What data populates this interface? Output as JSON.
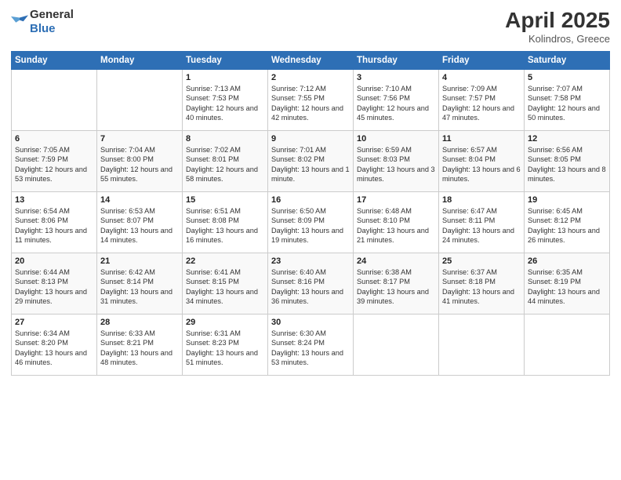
{
  "logo": {
    "general": "General",
    "blue": "Blue"
  },
  "title": {
    "month": "April 2025",
    "location": "Kolindros, Greece"
  },
  "weekdays": [
    "Sunday",
    "Monday",
    "Tuesday",
    "Wednesday",
    "Thursday",
    "Friday",
    "Saturday"
  ],
  "weeks": [
    [
      {
        "day": "",
        "info": ""
      },
      {
        "day": "",
        "info": ""
      },
      {
        "day": "1",
        "info": "Sunrise: 7:13 AM\nSunset: 7:53 PM\nDaylight: 12 hours and 40 minutes."
      },
      {
        "day": "2",
        "info": "Sunrise: 7:12 AM\nSunset: 7:55 PM\nDaylight: 12 hours and 42 minutes."
      },
      {
        "day": "3",
        "info": "Sunrise: 7:10 AM\nSunset: 7:56 PM\nDaylight: 12 hours and 45 minutes."
      },
      {
        "day": "4",
        "info": "Sunrise: 7:09 AM\nSunset: 7:57 PM\nDaylight: 12 hours and 47 minutes."
      },
      {
        "day": "5",
        "info": "Sunrise: 7:07 AM\nSunset: 7:58 PM\nDaylight: 12 hours and 50 minutes."
      }
    ],
    [
      {
        "day": "6",
        "info": "Sunrise: 7:05 AM\nSunset: 7:59 PM\nDaylight: 12 hours and 53 minutes."
      },
      {
        "day": "7",
        "info": "Sunrise: 7:04 AM\nSunset: 8:00 PM\nDaylight: 12 hours and 55 minutes."
      },
      {
        "day": "8",
        "info": "Sunrise: 7:02 AM\nSunset: 8:01 PM\nDaylight: 12 hours and 58 minutes."
      },
      {
        "day": "9",
        "info": "Sunrise: 7:01 AM\nSunset: 8:02 PM\nDaylight: 13 hours and 1 minute."
      },
      {
        "day": "10",
        "info": "Sunrise: 6:59 AM\nSunset: 8:03 PM\nDaylight: 13 hours and 3 minutes."
      },
      {
        "day": "11",
        "info": "Sunrise: 6:57 AM\nSunset: 8:04 PM\nDaylight: 13 hours and 6 minutes."
      },
      {
        "day": "12",
        "info": "Sunrise: 6:56 AM\nSunset: 8:05 PM\nDaylight: 13 hours and 8 minutes."
      }
    ],
    [
      {
        "day": "13",
        "info": "Sunrise: 6:54 AM\nSunset: 8:06 PM\nDaylight: 13 hours and 11 minutes."
      },
      {
        "day": "14",
        "info": "Sunrise: 6:53 AM\nSunset: 8:07 PM\nDaylight: 13 hours and 14 minutes."
      },
      {
        "day": "15",
        "info": "Sunrise: 6:51 AM\nSunset: 8:08 PM\nDaylight: 13 hours and 16 minutes."
      },
      {
        "day": "16",
        "info": "Sunrise: 6:50 AM\nSunset: 8:09 PM\nDaylight: 13 hours and 19 minutes."
      },
      {
        "day": "17",
        "info": "Sunrise: 6:48 AM\nSunset: 8:10 PM\nDaylight: 13 hours and 21 minutes."
      },
      {
        "day": "18",
        "info": "Sunrise: 6:47 AM\nSunset: 8:11 PM\nDaylight: 13 hours and 24 minutes."
      },
      {
        "day": "19",
        "info": "Sunrise: 6:45 AM\nSunset: 8:12 PM\nDaylight: 13 hours and 26 minutes."
      }
    ],
    [
      {
        "day": "20",
        "info": "Sunrise: 6:44 AM\nSunset: 8:13 PM\nDaylight: 13 hours and 29 minutes."
      },
      {
        "day": "21",
        "info": "Sunrise: 6:42 AM\nSunset: 8:14 PM\nDaylight: 13 hours and 31 minutes."
      },
      {
        "day": "22",
        "info": "Sunrise: 6:41 AM\nSunset: 8:15 PM\nDaylight: 13 hours and 34 minutes."
      },
      {
        "day": "23",
        "info": "Sunrise: 6:40 AM\nSunset: 8:16 PM\nDaylight: 13 hours and 36 minutes."
      },
      {
        "day": "24",
        "info": "Sunrise: 6:38 AM\nSunset: 8:17 PM\nDaylight: 13 hours and 39 minutes."
      },
      {
        "day": "25",
        "info": "Sunrise: 6:37 AM\nSunset: 8:18 PM\nDaylight: 13 hours and 41 minutes."
      },
      {
        "day": "26",
        "info": "Sunrise: 6:35 AM\nSunset: 8:19 PM\nDaylight: 13 hours and 44 minutes."
      }
    ],
    [
      {
        "day": "27",
        "info": "Sunrise: 6:34 AM\nSunset: 8:20 PM\nDaylight: 13 hours and 46 minutes."
      },
      {
        "day": "28",
        "info": "Sunrise: 6:33 AM\nSunset: 8:21 PM\nDaylight: 13 hours and 48 minutes."
      },
      {
        "day": "29",
        "info": "Sunrise: 6:31 AM\nSunset: 8:23 PM\nDaylight: 13 hours and 51 minutes."
      },
      {
        "day": "30",
        "info": "Sunrise: 6:30 AM\nSunset: 8:24 PM\nDaylight: 13 hours and 53 minutes."
      },
      {
        "day": "",
        "info": ""
      },
      {
        "day": "",
        "info": ""
      },
      {
        "day": "",
        "info": ""
      }
    ]
  ]
}
